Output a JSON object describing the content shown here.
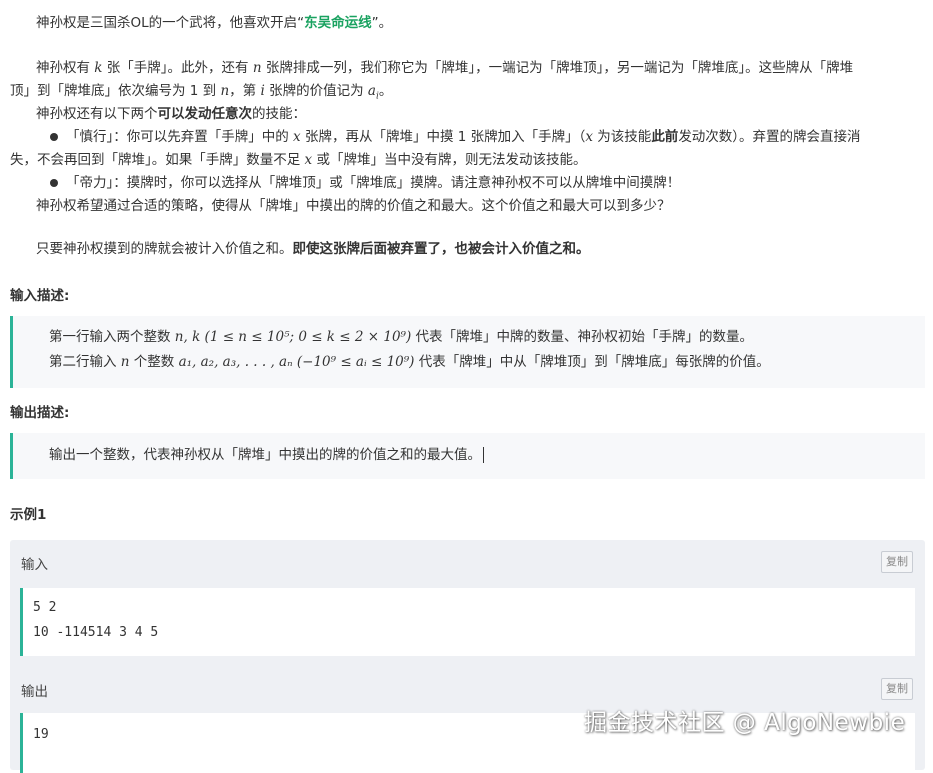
{
  "intro": {
    "line1_a": "神孙权是三国杀OL的一个武将，他喜欢开启“",
    "line1_b": "东吴命运线",
    "line1_c": "”。"
  },
  "para2": {
    "l1_a": "神孙权有 ",
    "l1_k": "k",
    "l1_b": " 张「手牌」。此外，还有 ",
    "l1_n": "n",
    "l1_c": " 张牌排成一列，我们称它为「牌堆」，一端记为「牌堆顶」，另一端记为「牌堆底」。这些牌从「牌堆",
    "l2_a": "顶」到「牌堆底」依次编号为 1 到 ",
    "l2_n": "n",
    "l2_b": "，第 ",
    "l2_i": "i",
    "l2_c": " 张牌的价值记为 ",
    "l2_ai": "a",
    "l2_sub": "i",
    "l2_d": "。",
    "l3_a": "神孙权还有以下两个",
    "l3_b": "可以发动任意次",
    "l3_c": "的技能：",
    "b1_a": "「慎行」：你可以先弃置「手牌」中的 ",
    "b1_x": "x",
    "b1_b": " 张牌，再从「牌堆」中摸 1 张牌加入「手牌」（",
    "b1_x2": "x",
    "b1_c": " 为该技能",
    "b1_d": "此前",
    "b1_e": "发动次数）。弃置的牌会直接消",
    "b1_l2_a": "失，不会再回到「牌堆」。如果「手牌」数量不足 ",
    "b1_l2_x": "x",
    "b1_l2_b": " 或「牌堆」当中没有牌，则无法发动该技能。",
    "b2": "「帝力」：摸牌时，你可以选择从「牌堆顶」或「牌堆底」摸牌。请注意神孙权不可以从牌堆中间摸牌！",
    "q": "神孙权希望通过合适的策略，使得从「牌堆」中摸出的牌的价值之和最大。这个价值之和最大可以到多少？"
  },
  "para3": {
    "a": "只要神孙权摸到的牌就会被计入价值之和。",
    "b": "即使这张牌后面被弃置了，也被会计入价值之和。"
  },
  "input_section": {
    "title": "输入描述:",
    "line1_a": "第一行输入两个整数 ",
    "line1_math": "n, k (1 ≤ n ≤ 10⁵; 0 ≤ k ≤ 2 × 10⁹)",
    "line1_b": " 代表「牌堆」中牌的数量、神孙权初始「手牌」的数量。",
    "line2_a": "第二行输入 ",
    "line2_n": "n",
    "line2_b": " 个整数 ",
    "line2_math": "a₁, a₂, a₃, . . . , aₙ (−10⁹ ≤ aᵢ ≤ 10⁹)",
    "line2_c": " 代表「牌堆」中从「牌堆顶」到「牌堆底」每张牌的价值。"
  },
  "output_section": {
    "title": "输出描述:",
    "line1": "输出一个整数，代表神孙权从「牌堆」中摸出的牌的价值之和的最大值。"
  },
  "example": {
    "title": "示例1",
    "input_label": "输入",
    "output_label": "输出",
    "copy_label": "复制",
    "input_lines": [
      "5 2",
      "10 -114514 3 4 5"
    ],
    "output_lines": [
      "19"
    ]
  },
  "watermark": "掘金技术社区 @ AlgoNewbie"
}
